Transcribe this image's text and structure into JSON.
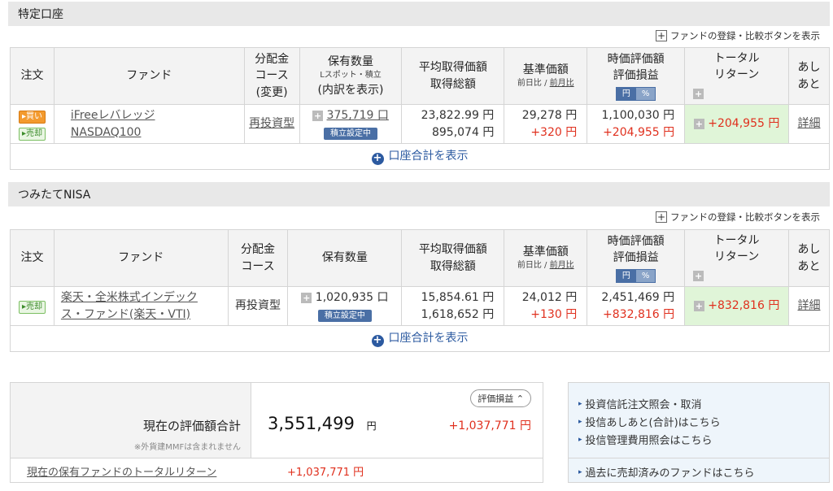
{
  "common": {
    "register_label": "ファンドの登録・比較ボタンを表示",
    "show_total_label": "口座合計を表示",
    "col_order": "注文",
    "col_fund": "ファンド",
    "col_buy_label": "買い",
    "col_sell_label": "売却",
    "col_return_l1": "トータル",
    "col_return_l2": "リターン",
    "col_history_l1": "あし",
    "col_history_l2": "あと",
    "col_avg_l1": "平均取得価額",
    "col_avg_l2": "取得総額",
    "col_base_l1": "基準価額",
    "col_base_sub_day": "前日比 / ",
    "col_base_sub_month": "前月比",
    "col_mkt_l1": "時価評価額",
    "col_mkt_l2": "評価損益",
    "toggle_yen": "円",
    "toggle_pct": "%",
    "detail_label": "詳細",
    "accum_label": "積立設定中"
  },
  "tokutei": {
    "title": "特定口座",
    "col_dist_l1": "分配金",
    "col_dist_l2": "コース",
    "col_dist_l3": "(変更)",
    "col_qty_l1": "保有数量",
    "col_qty_sub": "Lスポット・積立",
    "col_qty_l3": "(内訳を表示)",
    "fund_name_l1": "iFreeレバレッジ",
    "fund_name_l2": "NASDAQ100",
    "dist_course": "再投資型",
    "quantity": "375,719 口",
    "avg_price": "23,822.99 円",
    "total_cost": "895,074 円",
    "base_price": "29,278 円",
    "base_change": "+320 円",
    "market_value": "1,100,030 円",
    "unrealized": "+204,955 円",
    "total_return": "+204,955 円"
  },
  "nisa": {
    "title": "つみたてNISA",
    "col_dist_l1": "分配金",
    "col_dist_l2": "コース",
    "col_qty": "保有数量",
    "fund_name_l1": "楽天・全米株式インデック",
    "fund_name_l2": "ス・ファンド(楽天・VTI)",
    "dist_course": "再投資型",
    "quantity": "1,020,935 口",
    "avg_price": "15,854.61 円",
    "total_cost": "1,618,652 円",
    "base_price": "24,012 円",
    "base_change": "+130 円",
    "market_value": "2,451,469 円",
    "unrealized": "+832,816 円",
    "total_return": "+832,816 円"
  },
  "summary": {
    "label": "現在の評価額合計",
    "value": "3,551,499",
    "unit": "円",
    "note": "※外貨建MMFは含まれません",
    "toggle_label": "評価損益",
    "gain": "+1,037,771 円",
    "return_label": "現在の保有ファンドのトータルリターン",
    "return_value": "+1,037,771 円"
  },
  "links": {
    "item1": "投資信託注文照会・取消",
    "item2": "投信あしあと(合計)はこちら",
    "item3": "投信管理費用照会はこちら",
    "item4": "過去に売却済みのファンドはこちら"
  }
}
